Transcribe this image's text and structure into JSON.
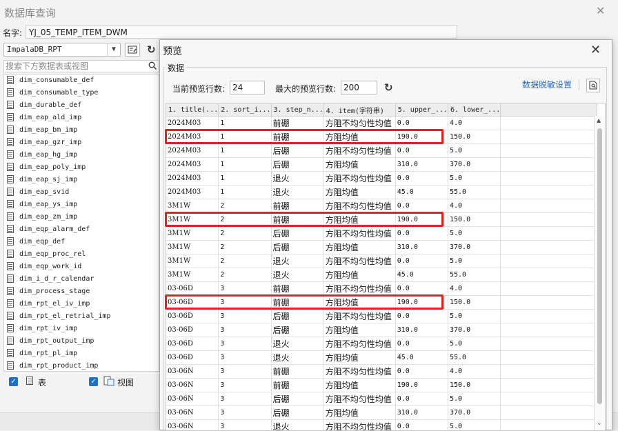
{
  "main_dialog": {
    "title": "数据库查询",
    "close_label": "✕",
    "name_label": "名字:",
    "name_value": "YJ_05_TEMP_ITEM_DWM",
    "db_selected": "ImpalaDB_RPT",
    "search_placeholder": "搜索下方数据表或视图",
    "tables": [
      "dim_consumable_def",
      "dim_consumable_type",
      "dim_durable_def",
      "dim_eap_ald_imp",
      "dim_eap_bm_imp",
      "dim_eap_gzr_imp",
      "dim_eap_hg_imp",
      "dim_eap_poly_imp",
      "dim_eap_sj_imp",
      "dim_eap_svid",
      "dim_eap_ys_imp",
      "dim_eap_zm_imp",
      "dim_eqp_alarm_def",
      "dim_eqp_def",
      "dim_eqp_proc_rel",
      "dim_eqp_work_id",
      "dim_i_d_r_calendar",
      "dim_process_stage",
      "dim_rpt_el_iv_imp",
      "dim_rpt_el_retrial_imp",
      "dim_rpt_iv_imp",
      "dim_rpt_output_imp",
      "dim_rpt_pl_imp",
      "dim_rpt_product_imp"
    ],
    "filter_table_label": "表",
    "filter_view_label": "视图"
  },
  "preview": {
    "title": "预览",
    "close_label": "✕",
    "group_label": "数据",
    "current_rows_label": "当前预览行数:",
    "current_rows_value": "24",
    "max_rows_label": "最大的预览行数:",
    "max_rows_value": "200",
    "mask_settings_label": "数据脱敏设置",
    "columns": [
      "1. title(...",
      "2. sort_i...",
      "3. step_n...",
      "4. item(字符串)",
      "5. upper_...",
      "6. lower_..."
    ],
    "rows": [
      [
        "2024M03",
        "1",
        "前硼",
        "方阻不均匀性均值",
        "0.0",
        "4.0"
      ],
      [
        "2024M03",
        "1",
        "前硼",
        "方阻均值",
        "190.0",
        "150.0"
      ],
      [
        "2024M03",
        "1",
        "后硼",
        "方阻不均匀性均值",
        "0.0",
        "5.0"
      ],
      [
        "2024M03",
        "1",
        "后硼",
        "方阻均值",
        "310.0",
        "370.0"
      ],
      [
        "2024M03",
        "1",
        "退火",
        "方阻不均匀性均值",
        "0.0",
        "5.0"
      ],
      [
        "2024M03",
        "1",
        "退火",
        "方阻均值",
        "45.0",
        "55.0"
      ],
      [
        "3M1W",
        "2",
        "前硼",
        "方阻不均匀性均值",
        "0.0",
        "4.0"
      ],
      [
        "3M1W",
        "2",
        "前硼",
        "方阻均值",
        "190.0",
        "150.0"
      ],
      [
        "3M1W",
        "2",
        "后硼",
        "方阻不均匀性均值",
        "0.0",
        "5.0"
      ],
      [
        "3M1W",
        "2",
        "后硼",
        "方阻均值",
        "310.0",
        "370.0"
      ],
      [
        "3M1W",
        "2",
        "退火",
        "方阻不均匀性均值",
        "0.0",
        "5.0"
      ],
      [
        "3M1W",
        "2",
        "退火",
        "方阻均值",
        "45.0",
        "55.0"
      ],
      [
        "03-06D",
        "3",
        "前硼",
        "方阻不均匀性均值",
        "0.0",
        "4.0"
      ],
      [
        "03-06D",
        "3",
        "前硼",
        "方阻均值",
        "190.0",
        "150.0"
      ],
      [
        "03-06D",
        "3",
        "后硼",
        "方阻不均匀性均值",
        "0.0",
        "5.0"
      ],
      [
        "03-06D",
        "3",
        "后硼",
        "方阻均值",
        "310.0",
        "370.0"
      ],
      [
        "03-06D",
        "3",
        "退火",
        "方阻不均匀性均值",
        "0.0",
        "5.0"
      ],
      [
        "03-06D",
        "3",
        "退火",
        "方阻均值",
        "45.0",
        "55.0"
      ],
      [
        "03-06N",
        "3",
        "前硼",
        "方阻不均匀性均值",
        "0.0",
        "4.0"
      ],
      [
        "03-06N",
        "3",
        "前硼",
        "方阻均值",
        "190.0",
        "150.0"
      ],
      [
        "03-06N",
        "3",
        "后硼",
        "方阻不均匀性均值",
        "0.0",
        "5.0"
      ],
      [
        "03-06N",
        "3",
        "后硼",
        "方阻均值",
        "310.0",
        "370.0"
      ],
      [
        "03-06N",
        "3",
        "退火",
        "方阻不均匀性均值",
        "0.0",
        "5.0"
      ]
    ],
    "highlighted_rows": [
      1,
      7,
      13
    ],
    "highlight_color": "#e0231b"
  },
  "colors": {
    "accent": "#1a73c8",
    "link": "#2a6db8"
  }
}
